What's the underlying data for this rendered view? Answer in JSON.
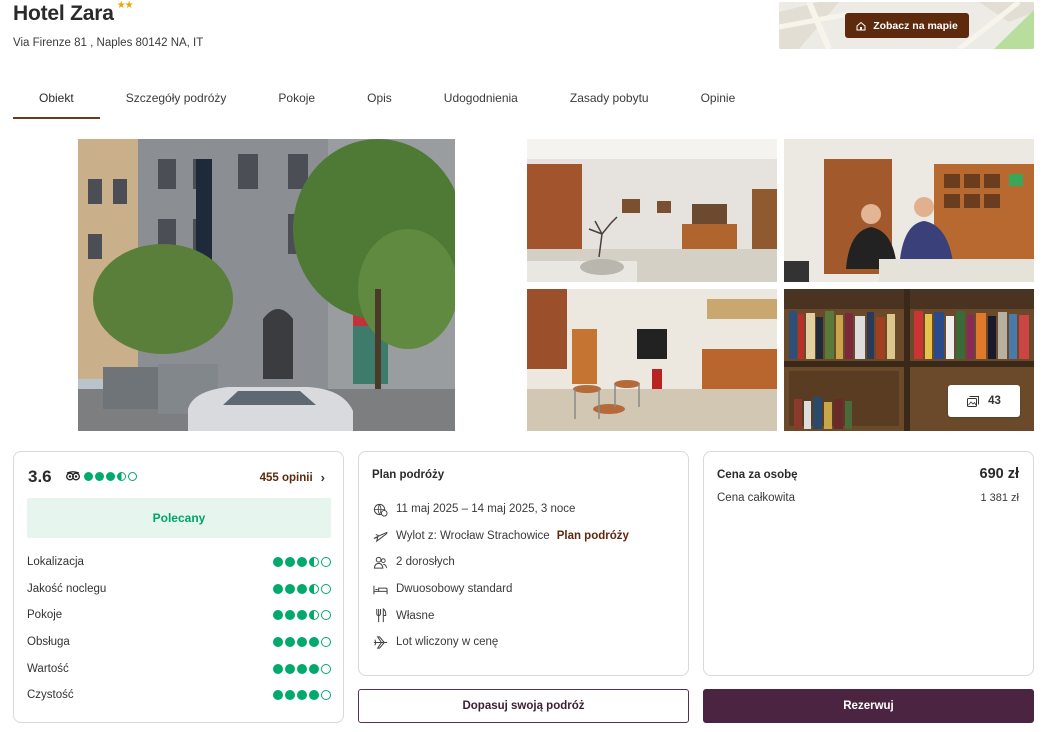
{
  "hotel": {
    "name": "Hotel Zara",
    "stars": "★★",
    "address": "Via Firenze 81 , Naples 80142 NA, IT"
  },
  "map": {
    "button_label": "Zobacz na mapie"
  },
  "tabs": [
    {
      "label": "Obiekt",
      "active": true
    },
    {
      "label": "Szczegóły podróży"
    },
    {
      "label": "Pokoje"
    },
    {
      "label": "Opis"
    },
    {
      "label": "Udogodnienia"
    },
    {
      "label": "Zasady pobytu"
    },
    {
      "label": "Opinie"
    }
  ],
  "gallery": {
    "photo_count": "43"
  },
  "rating": {
    "score": "3.6",
    "overall_dots": [
      1,
      1,
      1,
      0.5,
      0
    ],
    "reviews_label": "455 opinii",
    "badge": "Polecany",
    "criteria": [
      {
        "label": "Lokalizacja",
        "dots": [
          1,
          1,
          1,
          0.5,
          0
        ]
      },
      {
        "label": "Jakość noclegu",
        "dots": [
          1,
          1,
          1,
          0.5,
          0
        ]
      },
      {
        "label": "Pokoje",
        "dots": [
          1,
          1,
          1,
          0.5,
          0
        ]
      },
      {
        "label": "Obsługa",
        "dots": [
          1,
          1,
          1,
          1,
          0
        ]
      },
      {
        "label": "Wartość",
        "dots": [
          1,
          1,
          1,
          1,
          0
        ]
      },
      {
        "label": "Czystość",
        "dots": [
          1,
          1,
          1,
          1,
          0
        ]
      }
    ]
  },
  "trip": {
    "title": "Plan podróży",
    "dates": "11 maj 2025 – 14 maj 2025, 3 noce",
    "departure": "Wylot z: Wrocław Strachowice",
    "departure_link": "Plan podróży",
    "guests": "2 dorosłych",
    "room": "Dwuosobowy standard",
    "board": "Własne",
    "flight": "Lot wliczony w cenę",
    "icons": [
      "calendar-globe-icon",
      "plane-depart-icon",
      "people-icon",
      "bed-icon",
      "cutlery-icon",
      "plane-icon"
    ]
  },
  "price": {
    "per_person_label": "Cena za osobę",
    "per_person_value": "690 zł",
    "total_label": "Cena całkowita",
    "total_value": "1 381 zł"
  },
  "actions": {
    "customize_label": "Dopasuj swoją podróż",
    "book_label": "Rezerwuj"
  },
  "colors": {
    "accent_brown": "#5d2a0e",
    "primary_purple": "#4b2441",
    "tripadvisor_green": "#00aa6c",
    "recommended_bg": "#e6f6ef"
  }
}
